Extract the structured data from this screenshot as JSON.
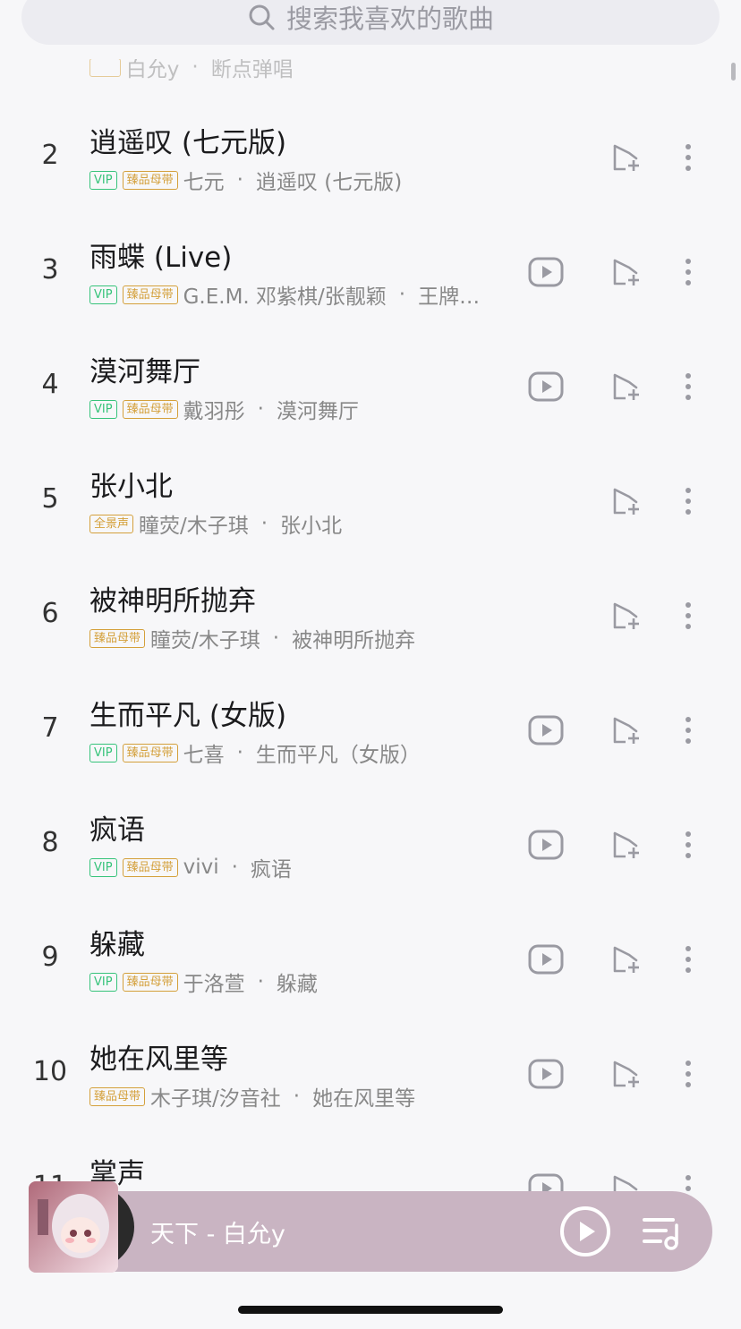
{
  "search": {
    "placeholder": "搜索我喜欢的歌曲"
  },
  "songs": [
    {
      "rank": "2",
      "title": "逍遥叹 (七元版)",
      "badges": [
        "VIP",
        "臻品母带"
      ],
      "artist": "七元",
      "album": "逍遥叹 (七元版)",
      "mv": false
    },
    {
      "rank": "3",
      "title": "雨蝶 (Live)",
      "badges": [
        "VIP",
        "臻品母带"
      ],
      "artist": "G.E.M. 邓紫棋/张靓颖",
      "album": "王牌…",
      "mv": true
    },
    {
      "rank": "4",
      "title": "漠河舞厅",
      "badges": [
        "VIP",
        "臻品母带"
      ],
      "artist": "戴羽彤",
      "album": "漠河舞厅",
      "mv": true
    },
    {
      "rank": "5",
      "title": "张小北",
      "badges": [
        "全景声"
      ],
      "artist": "瞳荧/木子琪",
      "album": "张小北",
      "mv": false
    },
    {
      "rank": "6",
      "title": "被神明所抛弃",
      "badges": [
        "臻品母带"
      ],
      "artist": "瞳荧/木子琪",
      "album": "被神明所抛弃",
      "mv": false
    },
    {
      "rank": "7",
      "title": "生而平凡 (女版)",
      "badges": [
        "VIP",
        "臻品母带"
      ],
      "artist": "七喜",
      "album": "生而平凡（女版）",
      "mv": true
    },
    {
      "rank": "8",
      "title": "疯语",
      "badges": [
        "VIP",
        "臻品母带"
      ],
      "artist": "vivi",
      "album": "疯语",
      "mv": true
    },
    {
      "rank": "9",
      "title": "躲藏",
      "badges": [
        "VIP",
        "臻品母带"
      ],
      "artist": "于洛萱",
      "album": "躲藏",
      "mv": true
    },
    {
      "rank": "10",
      "title": "她在风里等",
      "badges": [
        "臻品母带"
      ],
      "artist": "木子琪/汐音社",
      "album": "她在风里等",
      "mv": true
    },
    {
      "rank": "11",
      "title": "掌声",
      "badges": [],
      "artist": "",
      "album": "",
      "mv": true
    }
  ],
  "partial_top": {
    "artist": "白允y",
    "album": "断点弹唱"
  },
  "player": {
    "now_playing": "天下  - 白允y"
  },
  "colors": {
    "vip": "#36c37a",
    "gold": "#d4a03b",
    "player_bg": "#c9b4c2"
  }
}
